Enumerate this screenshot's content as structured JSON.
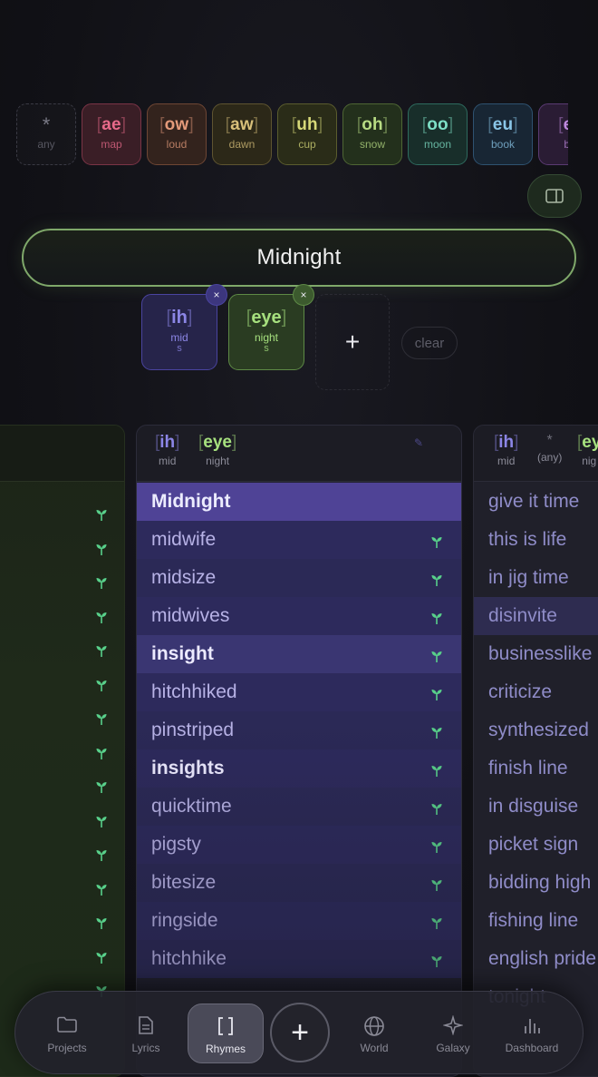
{
  "vowels": [
    {
      "sym": "ae",
      "word": "map",
      "color": "#e86a8a",
      "bg": "#3a1e26",
      "border": "#7a3446"
    },
    {
      "sym": "ow",
      "word": "loud",
      "color": "#e49a7a",
      "bg": "#33231d",
      "border": "#6e4634"
    },
    {
      "sym": "aw",
      "word": "dawn",
      "color": "#d8c07a",
      "bg": "#2c2818",
      "border": "#5e5430"
    },
    {
      "sym": "uh",
      "word": "cup",
      "color": "#d6d878",
      "bg": "#2a2c18",
      "border": "#5a5c2e"
    },
    {
      "sym": "oh",
      "word": "snow",
      "color": "#b8dc84",
      "bg": "#23301c",
      "border": "#4e6634"
    },
    {
      "sym": "oo",
      "word": "moon",
      "color": "#7ee0c6",
      "bg": "#182e2a",
      "border": "#2e6a5e"
    },
    {
      "sym": "eu",
      "word": "book",
      "color": "#8ac6e8",
      "bg": "#182634",
      "border": "#2e5270"
    },
    {
      "sym": "e",
      "word": "bi",
      "color": "#c08ae0",
      "bg": "#2a1c34",
      "border": "#5a3a72"
    }
  ],
  "any_chip": {
    "star": "*",
    "word": "any"
  },
  "search": {
    "value": "Midnight"
  },
  "tokens": [
    {
      "sym": "ih",
      "word": "mid",
      "len": "s",
      "color": "#8c86e6",
      "bg": "#26244a",
      "border": "#4a44a0",
      "xbg": "#3c367e"
    },
    {
      "sym": "eye",
      "word": "night",
      "len": "s",
      "color": "#a6e07e",
      "bg": "#2a3c22",
      "border": "#5e8a46",
      "xbg": "#3c5a2e"
    }
  ],
  "add_token": "+",
  "clear_label": "clear",
  "close_glyph": "×",
  "bracket_open": "[",
  "bracket_close": "]",
  "mid_column": {
    "header": [
      {
        "sym": "ih",
        "word": "mid",
        "color": "#8c86e6"
      },
      {
        "sym": "eye",
        "word": "night",
        "color": "#a6e07e"
      }
    ],
    "edit_glyph": "✎",
    "rows": [
      {
        "text": "Midnight",
        "style": "hl"
      },
      {
        "text": "midwife",
        "style": "normal"
      },
      {
        "text": "midsize",
        "style": "normal"
      },
      {
        "text": "midwives",
        "style": "normal"
      },
      {
        "text": "insight",
        "style": "hl-soft bold"
      },
      {
        "text": "hitchhiked",
        "style": "normal"
      },
      {
        "text": "pinstriped",
        "style": "normal"
      },
      {
        "text": "insights",
        "style": "bold"
      },
      {
        "text": "quicktime",
        "style": "normal"
      },
      {
        "text": "pigsty",
        "style": "normal"
      },
      {
        "text": "bitesize",
        "style": "normal"
      },
      {
        "text": "ringside",
        "style": "normal"
      },
      {
        "text": "hitchhike",
        "style": "normal"
      }
    ]
  },
  "right_column": {
    "header": [
      {
        "sym": "ih",
        "word": "mid",
        "color": "#8c86e6"
      },
      {
        "sym": "*",
        "word": "(any)",
        "color": "#6e6e7a"
      },
      {
        "sym": "ey",
        "word": "nig",
        "color": "#a6e07e"
      }
    ],
    "rows": [
      {
        "text": "give it time",
        "style": "normal"
      },
      {
        "text": "this is life",
        "style": "normal"
      },
      {
        "text": "in jig time",
        "style": "normal"
      },
      {
        "text": "disinvite",
        "style": "hl-soft"
      },
      {
        "text": "businesslike",
        "style": "normal"
      },
      {
        "text": "criticize",
        "style": "normal"
      },
      {
        "text": "synthesized",
        "style": "normal"
      },
      {
        "text": "finish line",
        "style": "normal"
      },
      {
        "text": "in disguise",
        "style": "normal"
      },
      {
        "text": "picket sign",
        "style": "normal"
      },
      {
        "text": "bidding high",
        "style": "normal"
      },
      {
        "text": "fishing line",
        "style": "normal"
      },
      {
        "text": "english pride",
        "style": "normal"
      },
      {
        "text": "tonight",
        "style": "normal"
      }
    ]
  },
  "nav": [
    {
      "label": "Projects",
      "icon": "folder-icon"
    },
    {
      "label": "Lyrics",
      "icon": "document-icon"
    },
    {
      "label": "Rhymes",
      "icon": "brackets-icon",
      "active": true
    },
    {
      "label": "World",
      "icon": "globe-icon"
    },
    {
      "label": "Galaxy",
      "icon": "sparkle-icon"
    },
    {
      "label": "Dashboard",
      "icon": "bar-chart-icon"
    }
  ],
  "fab_glyph": "+",
  "colors": {
    "sprout": "#58d08a",
    "accent": "#4f4396",
    "search_border": "#7fa86a"
  }
}
